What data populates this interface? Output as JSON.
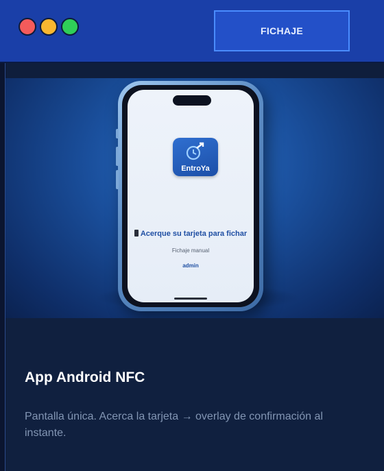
{
  "window": {
    "controls": [
      "close",
      "minimize",
      "maximize"
    ],
    "button_label": "FICHAJE"
  },
  "colors": {
    "titlebar": "#1a3fa8",
    "button": "#2350c8",
    "card": "#10203f",
    "accent": "#4a8cff"
  },
  "phone_screen": {
    "app_name": "EntroYa",
    "nfc_prompt": "Acerque su tarjeta para fichar",
    "manual_link": "Fichaje manual",
    "admin_link": "admin"
  },
  "card": {
    "title": "App Android NFC",
    "description": "Pantalla única. Acerca la tarjeta → overlay de confirmación al instante."
  }
}
